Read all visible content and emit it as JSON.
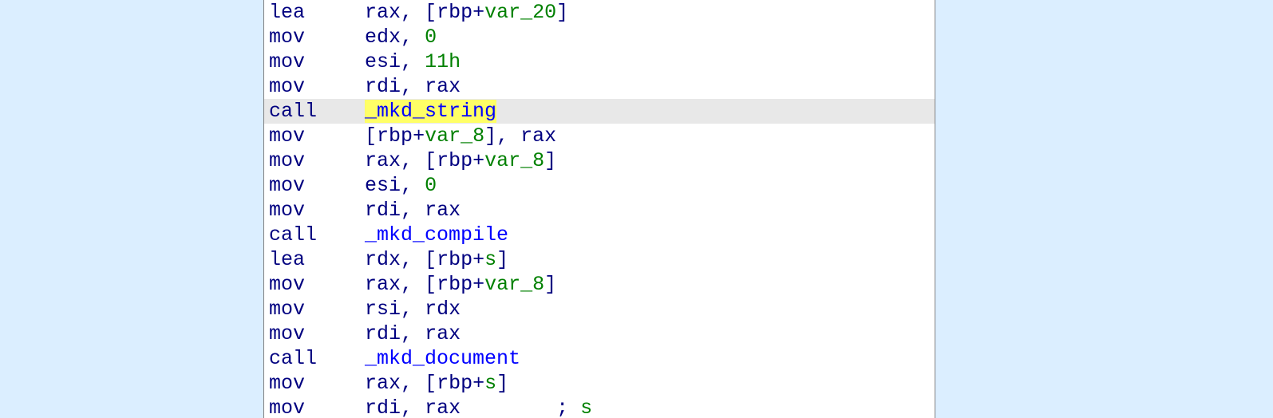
{
  "colors": {
    "background": "#dbeeff",
    "panel_bg": "#ffffff",
    "border": "#808080",
    "mnemonic": "#000080",
    "literal": "#008000",
    "function": "#0000ff",
    "highlight_line_bg": "#e8e8e8",
    "selected_text_bg": "#ffff66"
  },
  "selected_identifier": "_mkd_string",
  "lines": [
    {
      "highlight": false,
      "tokens": [
        [
          "mn",
          "lea"
        ],
        [
          "pad",
          "     "
        ],
        [
          "reg",
          "rax"
        ],
        [
          "reg",
          ", ["
        ],
        [
          "reg",
          "rbp"
        ],
        [
          "reg",
          "+"
        ],
        [
          "var",
          "var_20"
        ],
        [
          "reg",
          "]"
        ]
      ]
    },
    {
      "highlight": false,
      "tokens": [
        [
          "mn",
          "mov"
        ],
        [
          "pad",
          "     "
        ],
        [
          "reg",
          "edx"
        ],
        [
          "reg",
          ", "
        ],
        [
          "num",
          "0"
        ]
      ]
    },
    {
      "highlight": false,
      "tokens": [
        [
          "mn",
          "mov"
        ],
        [
          "pad",
          "     "
        ],
        [
          "reg",
          "esi"
        ],
        [
          "reg",
          ", "
        ],
        [
          "num",
          "11h"
        ]
      ]
    },
    {
      "highlight": false,
      "tokens": [
        [
          "mn",
          "mov"
        ],
        [
          "pad",
          "     "
        ],
        [
          "reg",
          "rdi"
        ],
        [
          "reg",
          ", "
        ],
        [
          "reg",
          "rax"
        ]
      ]
    },
    {
      "highlight": true,
      "tokens": [
        [
          "mn",
          "call"
        ],
        [
          "pad",
          "    "
        ],
        [
          "sel",
          "_mkd_string"
        ]
      ]
    },
    {
      "highlight": false,
      "tokens": [
        [
          "mn",
          "mov"
        ],
        [
          "pad",
          "     "
        ],
        [
          "reg",
          "["
        ],
        [
          "reg",
          "rbp"
        ],
        [
          "reg",
          "+"
        ],
        [
          "var",
          "var_8"
        ],
        [
          "reg",
          "], "
        ],
        [
          "reg",
          "rax"
        ]
      ]
    },
    {
      "highlight": false,
      "tokens": [
        [
          "mn",
          "mov"
        ],
        [
          "pad",
          "     "
        ],
        [
          "reg",
          "rax"
        ],
        [
          "reg",
          ", ["
        ],
        [
          "reg",
          "rbp"
        ],
        [
          "reg",
          "+"
        ],
        [
          "var",
          "var_8"
        ],
        [
          "reg",
          "]"
        ]
      ]
    },
    {
      "highlight": false,
      "tokens": [
        [
          "mn",
          "mov"
        ],
        [
          "pad",
          "     "
        ],
        [
          "reg",
          "esi"
        ],
        [
          "reg",
          ", "
        ],
        [
          "num",
          "0"
        ]
      ]
    },
    {
      "highlight": false,
      "tokens": [
        [
          "mn",
          "mov"
        ],
        [
          "pad",
          "     "
        ],
        [
          "reg",
          "rdi"
        ],
        [
          "reg",
          ", "
        ],
        [
          "reg",
          "rax"
        ]
      ]
    },
    {
      "highlight": false,
      "tokens": [
        [
          "mn",
          "call"
        ],
        [
          "pad",
          "    "
        ],
        [
          "func",
          "_mkd_compile"
        ]
      ]
    },
    {
      "highlight": false,
      "tokens": [
        [
          "mn",
          "lea"
        ],
        [
          "pad",
          "     "
        ],
        [
          "reg",
          "rdx"
        ],
        [
          "reg",
          ", ["
        ],
        [
          "reg",
          "rbp"
        ],
        [
          "reg",
          "+"
        ],
        [
          "var",
          "s"
        ],
        [
          "reg",
          "]"
        ]
      ]
    },
    {
      "highlight": false,
      "tokens": [
        [
          "mn",
          "mov"
        ],
        [
          "pad",
          "     "
        ],
        [
          "reg",
          "rax"
        ],
        [
          "reg",
          ", ["
        ],
        [
          "reg",
          "rbp"
        ],
        [
          "reg",
          "+"
        ],
        [
          "var",
          "var_8"
        ],
        [
          "reg",
          "]"
        ]
      ]
    },
    {
      "highlight": false,
      "tokens": [
        [
          "mn",
          "mov"
        ],
        [
          "pad",
          "     "
        ],
        [
          "reg",
          "rsi"
        ],
        [
          "reg",
          ", "
        ],
        [
          "reg",
          "rdx"
        ]
      ]
    },
    {
      "highlight": false,
      "tokens": [
        [
          "mn",
          "mov"
        ],
        [
          "pad",
          "     "
        ],
        [
          "reg",
          "rdi"
        ],
        [
          "reg",
          ", "
        ],
        [
          "reg",
          "rax"
        ]
      ]
    },
    {
      "highlight": false,
      "tokens": [
        [
          "mn",
          "call"
        ],
        [
          "pad",
          "    "
        ],
        [
          "func",
          "_mkd_document"
        ]
      ]
    },
    {
      "highlight": false,
      "tokens": [
        [
          "mn",
          "mov"
        ],
        [
          "pad",
          "     "
        ],
        [
          "reg",
          "rax"
        ],
        [
          "reg",
          ", ["
        ],
        [
          "reg",
          "rbp"
        ],
        [
          "reg",
          "+"
        ],
        [
          "var",
          "s"
        ],
        [
          "reg",
          "]"
        ]
      ]
    },
    {
      "highlight": false,
      "tokens": [
        [
          "mn",
          "mov"
        ],
        [
          "pad",
          "     "
        ],
        [
          "reg",
          "rdi"
        ],
        [
          "reg",
          ", "
        ],
        [
          "reg",
          "rax"
        ],
        [
          "pad",
          "        "
        ],
        [
          "reg",
          "; "
        ],
        [
          "var",
          "s"
        ]
      ]
    }
  ]
}
